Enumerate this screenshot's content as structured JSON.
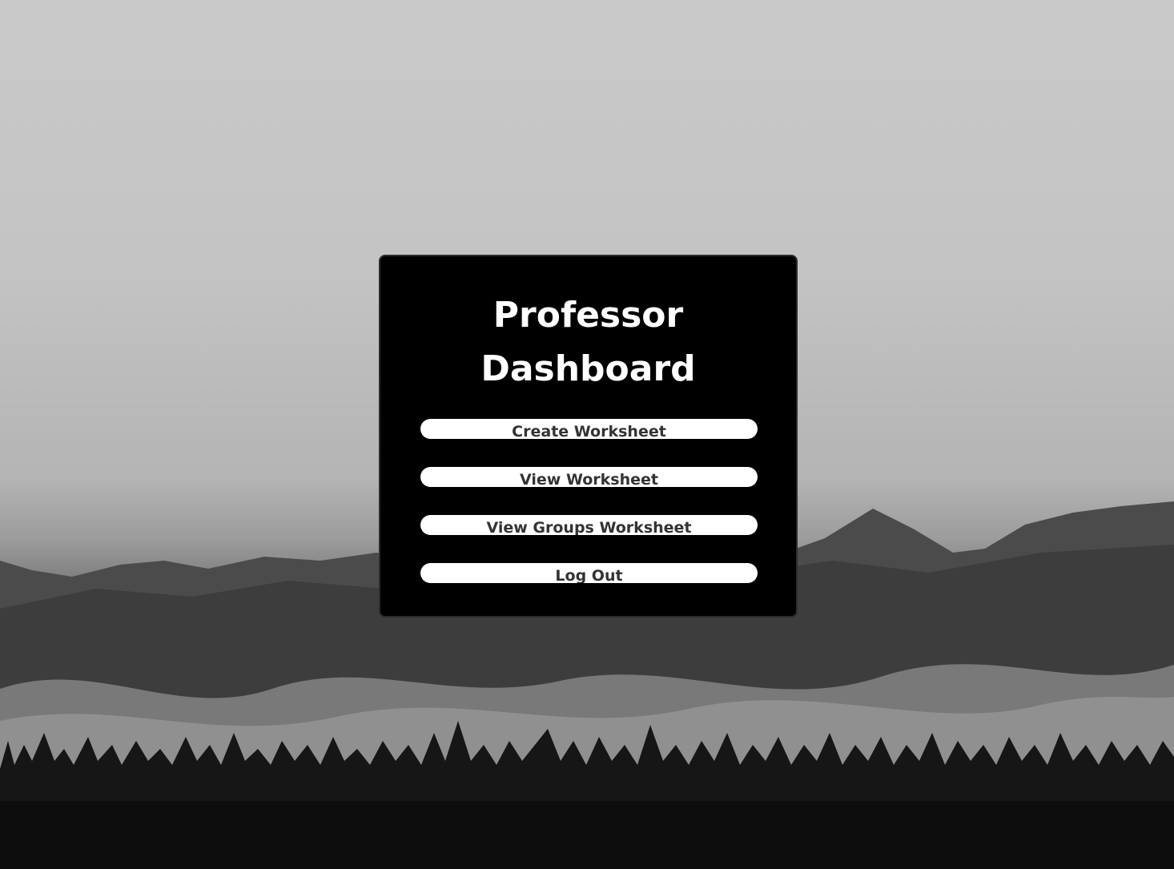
{
  "dashboard": {
    "title_line1": "Professor",
    "title_line2": "Dashboard"
  },
  "buttons": {
    "create_worksheet": "Create Worksheet",
    "view_worksheet": "View Worksheet",
    "view_groups_worksheet": "View Groups Worksheet",
    "log_out": "Log Out"
  },
  "colors": {
    "panel_background": "#000000",
    "title_text": "#ffffff",
    "button_background": "#ffffff",
    "button_text": "#333333"
  },
  "background": {
    "scene": "misty-mountains-forest-image"
  }
}
